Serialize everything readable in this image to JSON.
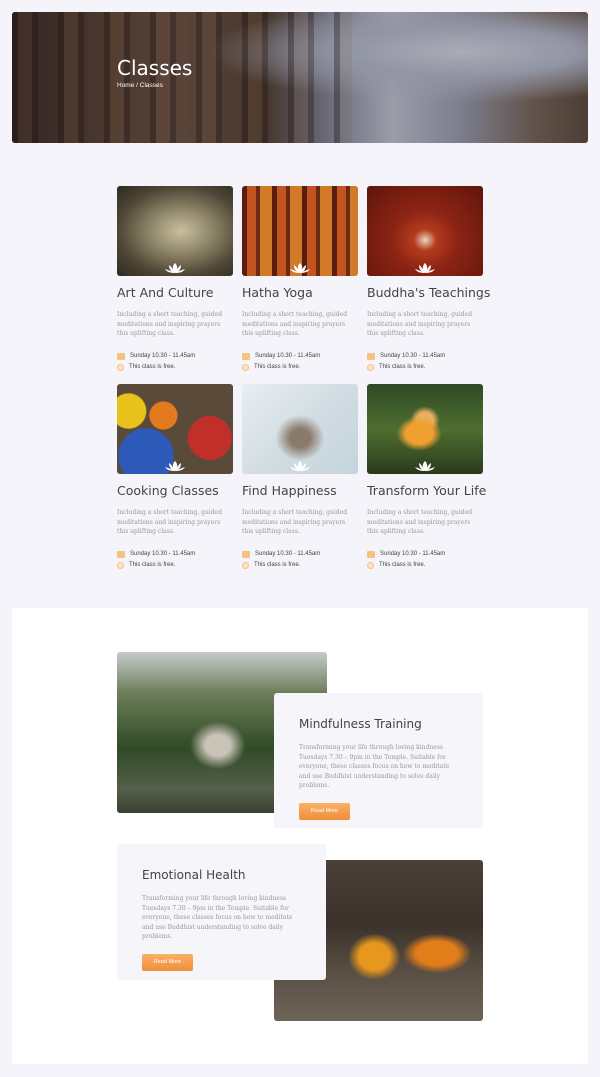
{
  "hero": {
    "title": "Classes",
    "breadcrumb": "Home / Classes"
  },
  "accent_color": "#f4a25a",
  "classes": [
    {
      "title": "Art And Culture",
      "desc": "Including a short teaching, guided meditations and inspiring prayers this uplifting class.",
      "time": "Sunday 10.30 - 11.45am",
      "price": "This class is free.",
      "image": "buddha-hand-statue"
    },
    {
      "title": "Hatha Yoga",
      "desc": "Including a short teaching, guided meditations and inspiring prayers this uplifting class.",
      "time": "Sunday 10.30 - 11.45am",
      "price": "This class is free.",
      "image": "temple-drums"
    },
    {
      "title": "Buddha's Teachings",
      "desc": "Including a short teaching, guided meditations and inspiring prayers this uplifting class.",
      "time": "Sunday 10.30 - 11.45am",
      "price": "This class is free.",
      "image": "torii-gates"
    },
    {
      "title": "Cooking Classes",
      "desc": "Including a short teaching, guided meditations and inspiring prayers this uplifting class.",
      "time": "Sunday 10.30 - 11.45am",
      "price": "This class is free.",
      "image": "spice-bowls"
    },
    {
      "title": "Find Happiness",
      "desc": "Including a short teaching, guided meditations and inspiring prayers this uplifting class.",
      "time": "Sunday 10.30 - 11.45am",
      "price": "This class is free.",
      "image": "sage-bundle"
    },
    {
      "title": "Transform Your Life",
      "desc": "Including a short teaching, guided meditations and inspiring prayers this uplifting class.",
      "time": "Sunday 10.30 - 11.45am",
      "price": "This class is free.",
      "image": "golden-buddha-garden"
    }
  ],
  "features": [
    {
      "title": "Mindfulness Training",
      "desc": "Transforming your life through loving kindness Tuesdays 7.30 – 9pm in the Temple. Suitable for everyone, these classes focus on how to meditate and use Buddhist understanding to solve daily problems.",
      "button": "Read More",
      "image": "misty-temple"
    },
    {
      "title": "Emotional Health",
      "desc": "Transforming your life through loving kindness Tuesdays 7.30 – 9pm in the Temple. Suitable for everyone, these classes focus on how to meditate and use Buddhist understanding to solve daily problems.",
      "button": "Read More",
      "image": "monks-walking"
    }
  ]
}
